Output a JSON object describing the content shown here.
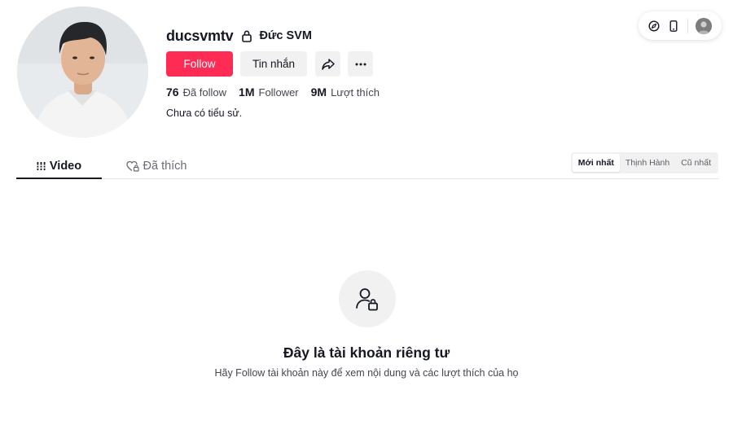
{
  "profile": {
    "username": "ducsvmtv",
    "nickname": "Đức SVM",
    "bio": "Chưa có tiểu sử.",
    "avatar_icon": "profile-photo"
  },
  "actions": {
    "follow_label": "Follow",
    "message_label": "Tin nhắn",
    "share_icon": "share-icon",
    "more_icon": "more-icon"
  },
  "stats": [
    {
      "value": "76",
      "label": "Đã follow"
    },
    {
      "value": "1M",
      "label": "Follower"
    },
    {
      "value": "9M",
      "label": "Lượt thích"
    }
  ],
  "tabs": [
    {
      "label": "Video",
      "icon": "grid-icon",
      "active": true
    },
    {
      "label": "Đã thích",
      "icon": "heart-lock-icon",
      "active": false
    }
  ],
  "sort": [
    {
      "label": "Mới nhất",
      "active": true
    },
    {
      "label": "Thịnh Hành",
      "active": false
    },
    {
      "label": "Cũ nhất",
      "active": false
    }
  ],
  "top_right": {
    "icons": [
      "compass-icon",
      "phone-icon",
      "user-avatar"
    ]
  },
  "empty_state": {
    "icon": "user-lock-icon",
    "title": "Đây là tài khoản riêng tư",
    "subtitle": "Hãy Follow tài khoản này để xem nội dung và các lượt thích của họ"
  },
  "colors": {
    "accent": "#fe2c55",
    "text": "#161823",
    "muted_bg": "#f1f1f2"
  }
}
